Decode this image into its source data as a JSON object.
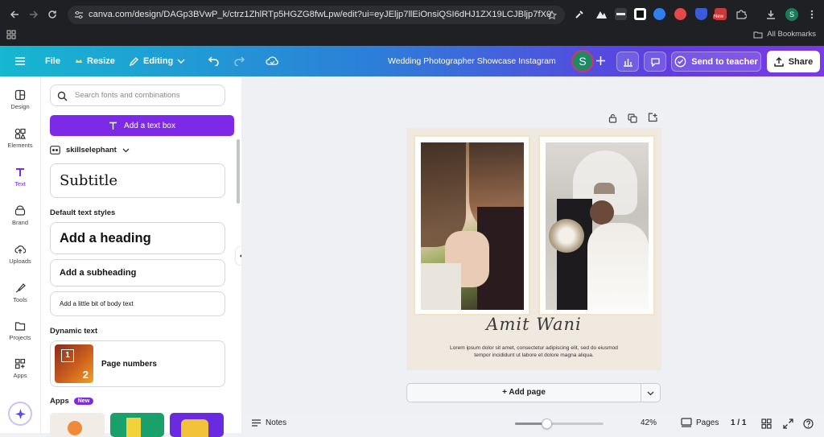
{
  "browser": {
    "url": "canva.com/design/DAGp3BVwP_k/ctrz1ZhlRTp5HGZG8fwLpw/edit?ui=eyJEljp7llEiOnsiQSI6dHJ1ZX19LCJBljp7fX0",
    "new_badge": "New",
    "avatar_letter": "S",
    "bookmarks_label": "All Bookmarks"
  },
  "topbar": {
    "file": "File",
    "resize": "Resize",
    "editing": "Editing",
    "design_title": "Wedding Photographer Showcase Instagram",
    "avatar_letter": "S",
    "send_to_teacher": "Send to teacher",
    "share": "Share"
  },
  "rail": {
    "design": "Design",
    "elements": "Elements",
    "text": "Text",
    "brand": "Brand",
    "uploads": "Uploads",
    "tools": "Tools",
    "projects": "Projects",
    "apps": "Apps"
  },
  "panel": {
    "search_placeholder": "Search fonts and combinations",
    "add_text_box": "Add a text box",
    "brand_kit_name": "skillselephant",
    "subtitle_sample": "Subtitle",
    "default_styles_heading": "Default text styles",
    "add_heading": "Add a heading",
    "add_subheading": "Add a subheading",
    "add_body": "Add a little bit of body text",
    "dynamic_text_heading": "Dynamic text",
    "page_numbers": "Page numbers",
    "page_icon_1": "1",
    "page_icon_2": "2",
    "apps_heading": "Apps",
    "apps_badge": "New"
  },
  "design": {
    "signature": "Amit Wani",
    "body_line1": "Lorem ipsum dolor sit amet, consectetur adipiscing elit, sed do eiusmod",
    "body_line2": "tempor incididunt ut labore et dolore magna aliqua."
  },
  "canvas": {
    "add_page": "+ Add page"
  },
  "bottombar": {
    "notes": "Notes",
    "zoom": 42,
    "zoom_label": "42%",
    "pages": "Pages",
    "page_count": "1 / 1"
  },
  "colors": {
    "accent_purple": "#7d2ae8",
    "design_bg": "#efe9df",
    "photo_frame": "#f3e6c9"
  }
}
